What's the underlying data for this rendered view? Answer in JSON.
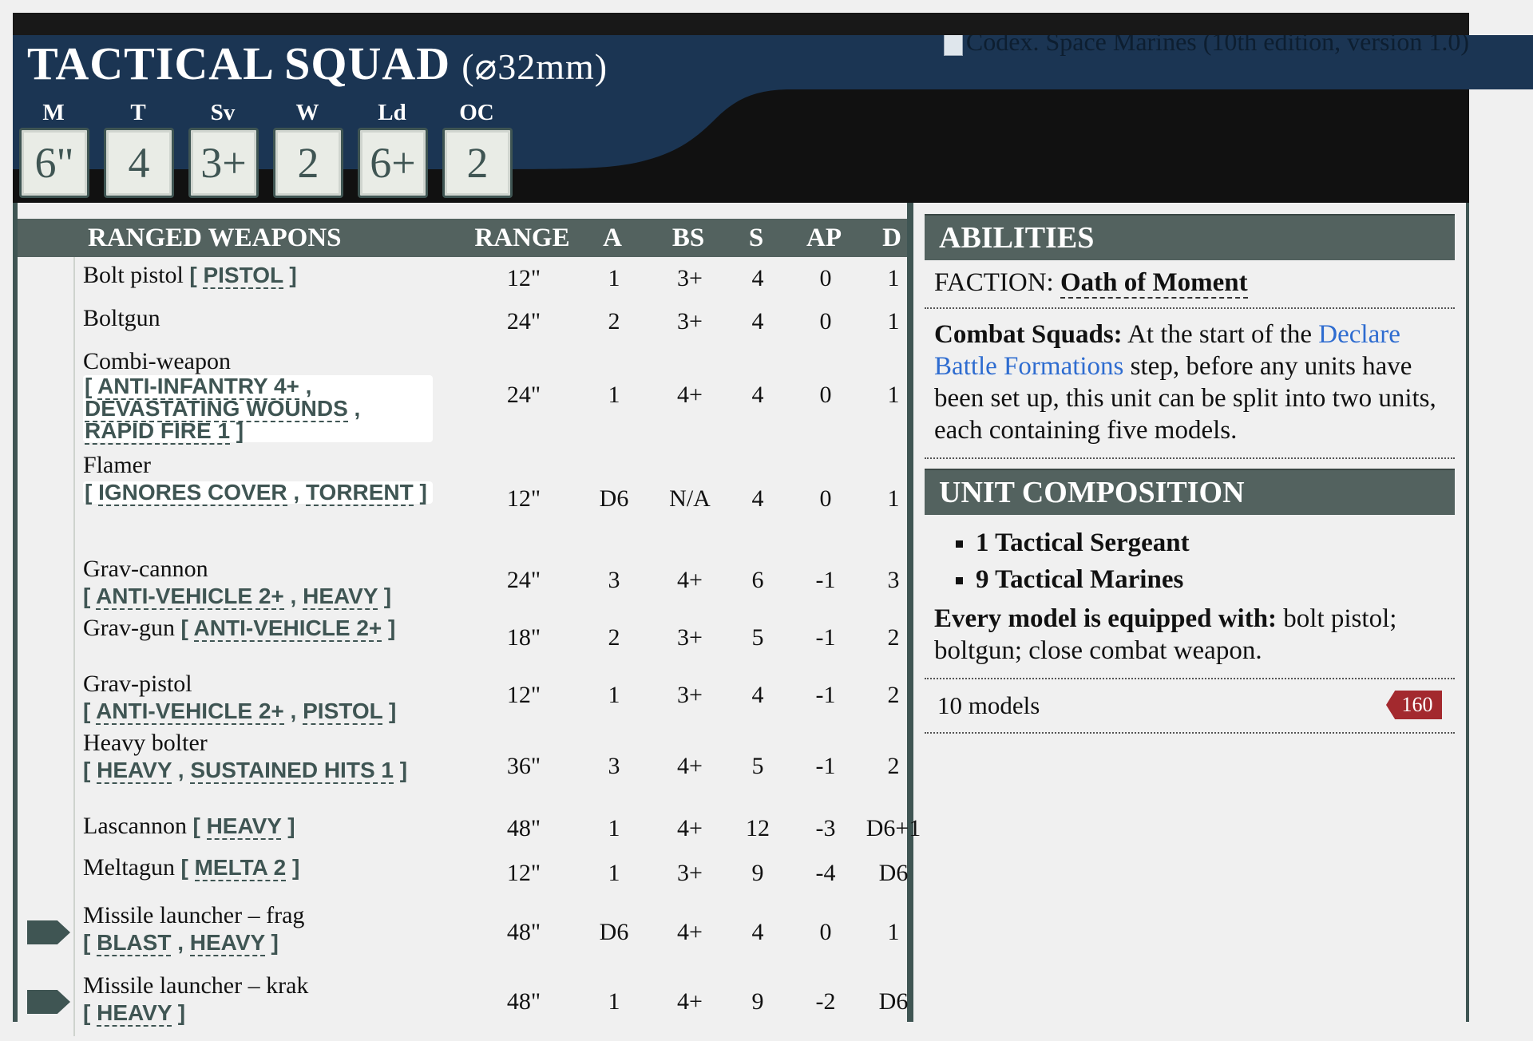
{
  "unit": {
    "name": "TACTICAL SQUAD",
    "base": "(⌀32mm)",
    "codex_link_text": "Codex. Space Marines (10th edition, version 1.0)"
  },
  "stats": [
    {
      "label": "M",
      "value": "6\""
    },
    {
      "label": "T",
      "value": "4"
    },
    {
      "label": "Sv",
      "value": "3+"
    },
    {
      "label": "W",
      "value": "2"
    },
    {
      "label": "Ld",
      "value": "6+"
    },
    {
      "label": "OC",
      "value": "2"
    }
  ],
  "weapons": {
    "header": {
      "name": "RANGED WEAPONS",
      "range": "RANGE",
      "a": "A",
      "bs": "BS",
      "s": "S",
      "ap": "AP",
      "d": "D"
    },
    "rows": [
      {
        "name": "Bolt pistol",
        "kw": [
          "PISTOL"
        ],
        "range": "12\"",
        "a": "1",
        "bs": "3+",
        "s": "4",
        "ap": "0",
        "d": "1"
      },
      {
        "name": "Boltgun",
        "kw": [],
        "range": "24\"",
        "a": "2",
        "bs": "3+",
        "s": "4",
        "ap": "0",
        "d": "1"
      },
      {
        "name": "Combi-weapon",
        "kw": [
          "ANTI-INFANTRY 4+",
          "DEVASTATING WOUNDS",
          "RAPID FIRE 1"
        ],
        "range": "24\"",
        "a": "1",
        "bs": "4+",
        "s": "4",
        "ap": "0",
        "d": "1"
      },
      {
        "name": "Flamer",
        "kw": [
          "IGNORES COVER",
          "TORRENT"
        ],
        "range": "12\"",
        "a": "D6",
        "bs": "N/A",
        "s": "4",
        "ap": "0",
        "d": "1"
      },
      {
        "name": "Grav-cannon",
        "kw": [
          "ANTI-VEHICLE 2+",
          "HEAVY"
        ],
        "range": "24\"",
        "a": "3",
        "bs": "4+",
        "s": "6",
        "ap": "-1",
        "d": "3"
      },
      {
        "name": "Grav-gun",
        "kw": [
          "ANTI-VEHICLE 2+"
        ],
        "range": "18\"",
        "a": "2",
        "bs": "3+",
        "s": "5",
        "ap": "-1",
        "d": "2"
      },
      {
        "name": "Grav-pistol",
        "kw": [
          "ANTI-VEHICLE 2+",
          "PISTOL"
        ],
        "range": "12\"",
        "a": "1",
        "bs": "3+",
        "s": "4",
        "ap": "-1",
        "d": "2"
      },
      {
        "name": "Heavy bolter",
        "kw": [
          "HEAVY",
          "SUSTAINED HITS 1"
        ],
        "range": "36\"",
        "a": "3",
        "bs": "4+",
        "s": "5",
        "ap": "-1",
        "d": "2"
      },
      {
        "name": "Lascannon",
        "kw": [
          "HEAVY"
        ],
        "range": "48\"",
        "a": "1",
        "bs": "4+",
        "s": "12",
        "ap": "-3",
        "d": "D6+1"
      },
      {
        "name": "Meltagun",
        "kw": [
          "MELTA 2"
        ],
        "range": "12\"",
        "a": "1",
        "bs": "3+",
        "s": "9",
        "ap": "-4",
        "d": "D6"
      },
      {
        "name": "Missile launcher – frag",
        "kw": [
          "BLAST",
          "HEAVY"
        ],
        "range": "48\"",
        "a": "D6",
        "bs": "4+",
        "s": "4",
        "ap": "0",
        "d": "1"
      },
      {
        "name": "Missile launcher – krak",
        "kw": [
          "HEAVY"
        ],
        "range": "48\"",
        "a": "1",
        "bs": "4+",
        "s": "9",
        "ap": "-2",
        "d": "D6"
      }
    ]
  },
  "abilities": {
    "title": "ABILITIES",
    "faction_label": "FACTION:",
    "faction_value": "Oath of Moment",
    "combat_title": "Combat Squads:",
    "combat_pre": " At the start of the ",
    "combat_link": "Declare Battle Formations",
    "combat_post": " step, before any units have been set up, this unit can be split into two units, each containing five models."
  },
  "composition": {
    "title": "UNIT COMPOSITION",
    "items": [
      "1 Tactical Sergeant",
      "9 Tactical Marines"
    ],
    "equip_label": "Every model is equipped with:",
    "equip_text": " bolt pistol; boltgun; close combat weapon.",
    "models": "10 models",
    "points": "160"
  },
  "colors": {
    "accent": "#3f5553",
    "header_blue": "#1b3553",
    "link": "#2e6cd0",
    "points": "#a3292e"
  }
}
